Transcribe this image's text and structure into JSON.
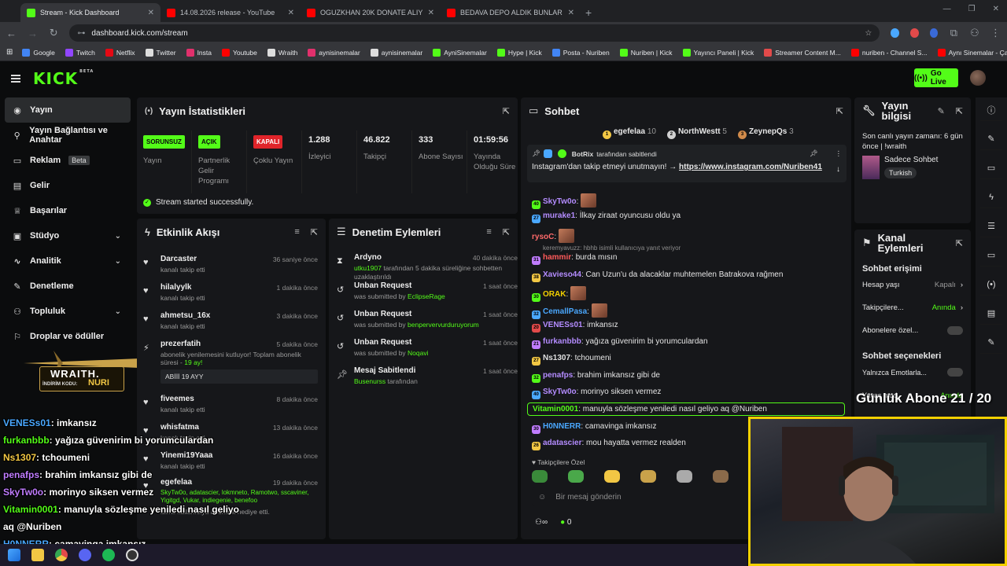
{
  "browser": {
    "tabs": [
      {
        "title": "Stream - Kick Dashboard",
        "color": "#53fc18",
        "active": true
      },
      {
        "title": "14.08.2026 release - YouTube",
        "color": "#ff0000",
        "active": false
      },
      {
        "title": "OGUZKHAN 20K DONATE ALIY",
        "color": "#ff0000",
        "active": false
      },
      {
        "title": "BEDAVA DEPO ALDIK BUNLAR",
        "color": "#ff0000",
        "active": false
      }
    ],
    "url": "dashboard.kick.com/stream",
    "bookmarks": [
      "Google",
      "Twitch",
      "Netflix",
      "Twitter",
      "Insta",
      "Youtube",
      "Wraith",
      "aynisinemalar",
      "aynisinemalar",
      "AyniSinemalar",
      "Hype | Kick",
      "Posta - Nuriben",
      "Nuriben | Kick",
      "Yayıncı Paneli | Kick",
      "Streamer Content M...",
      "nuriben - Channel S...",
      "Aynı Sinemalar - Ça..."
    ]
  },
  "header": {
    "logo": "KICK",
    "beta": "BETA",
    "go_live": "Go Live"
  },
  "sidebar": {
    "items": [
      {
        "label": "Yayın",
        "icon": "broadcast-icon"
      },
      {
        "label": "Yayın Bağlantısı ve Anahtar",
        "icon": "link-icon"
      },
      {
        "label": "Reklam",
        "icon": "ad-icon",
        "tag": "Beta"
      },
      {
        "label": "Gelir",
        "icon": "money-icon"
      },
      {
        "label": "Başarılar",
        "icon": "trophy-icon"
      },
      {
        "label": "Stüdyo",
        "icon": "studio-icon"
      },
      {
        "label": "Analitik",
        "icon": "chart-icon"
      },
      {
        "label": "Denetleme",
        "icon": "wrench-icon"
      },
      {
        "label": "Topluluk",
        "icon": "community-icon"
      },
      {
        "label": "Droplar ve ödüller",
        "icon": "gift-icon"
      }
    ]
  },
  "stats": {
    "title": "Yayın İstatistikleri",
    "items": [
      {
        "badge": "SORUNSUZ",
        "badge_color": "#53fc18",
        "label": "Yayın"
      },
      {
        "badge": "AÇIK",
        "badge_color": "#53fc18",
        "label": "Partnerlik Gelir Programı"
      },
      {
        "badge": "KAPALI",
        "badge_color": "#e0242a",
        "label": "Çoklu Yayın"
      },
      {
        "value": "1.288",
        "label": "İzleyici"
      },
      {
        "value": "46.822",
        "label": "Takipçi"
      },
      {
        "value": "333",
        "label": "Abone Sayısı"
      },
      {
        "value": "01:59:56",
        "label": "Yayında Olduğu Süre"
      }
    ],
    "status": "Stream started successfully."
  },
  "activity": {
    "title": "Etkinlik Akışı",
    "events": [
      {
        "name": "Darcaster",
        "text": "kanalı takip etti",
        "time": "36 saniye önce"
      },
      {
        "name": "hilalyylk",
        "text": "kanalı takip etti",
        "time": "1 dakika önce"
      },
      {
        "name": "ahmetsu_16x",
        "text": "kanalı takip etti",
        "time": "3 dakika önce"
      },
      {
        "name": "prezerfatih",
        "text": "abonelik yenilemesini kutluyor! Toplam abonelik süresi -",
        "highlight": "19 ay!",
        "time": "5 dakika önce",
        "message": "ABİİİ 19 AYY"
      },
      {
        "name": "fiveemes",
        "text": "kanalı takip etti",
        "time": "8 dakika önce"
      },
      {
        "name": "whisfatma",
        "text": "kanalı takip etti",
        "time": "13 dakika önce"
      },
      {
        "name": "Yinemi19Yaaa",
        "text": "kanalı takip etti",
        "time": "16 dakika önce"
      },
      {
        "name": "egefelaa",
        "text": "isimli kullanıcıya abonelik hediye etti.",
        "gifted": "SkyTw0o, adatascier, lokmneto, Ramotwo, sscaviner, Yigitgd, Vukar, indiegenie, benefoo",
        "time": "19 dakika önce"
      }
    ]
  },
  "moderation": {
    "title": "Denetim Eylemleri",
    "actions": [
      {
        "title": "Ardyno",
        "user": "utku1907",
        "text": "tarafından 5 dakika süreliğine sohbetten uzaklaştırıldı",
        "time": "40 dakika önce"
      },
      {
        "title": "Unban Request",
        "text": "was submitted by",
        "user": "EclipseRage",
        "time": "1 saat önce"
      },
      {
        "title": "Unban Request",
        "text": "was submitted by",
        "user": "benpervervurduruyorum",
        "time": "1 saat önce"
      },
      {
        "title": "Unban Request",
        "text": "was submitted by",
        "user": "Noqavi",
        "time": "1 saat önce"
      },
      {
        "title": "Mesaj Sabitlendi",
        "user": "Busenurss",
        "text": "tarafından",
        "time": "1 saat önce"
      }
    ]
  },
  "chat": {
    "title": "Sohbet",
    "top_gifters": [
      {
        "rank": "1",
        "name": "egefelaa",
        "count": "10"
      },
      {
        "rank": "2",
        "name": "NorthWestt",
        "count": "5"
      },
      {
        "rank": "3",
        "name": "ZeynepQs",
        "count": "3"
      }
    ],
    "pinned": {
      "by": "BotRix",
      "by_suffix": "tarafından sabitlendi",
      "text": "Instagram'dan takip etmeyi unutmayın! →",
      "link": "https://www.instagram.com/Nuriben41"
    },
    "reply_note": "keremyavuzz: hbhb isimli kullanıcıya yanıt veriyor",
    "messages": [
      {
        "user": "SkyTw0o",
        "color": "#b48cff",
        "text": "",
        "emote": true,
        "badge": "40"
      },
      {
        "user": "murake1",
        "color": "#b48cff",
        "text": "İlkay ziraat oyuncusu oldu ya",
        "badge": "27"
      },
      {
        "user": "rysoC",
        "color": "#ff6a6a",
        "text": "",
        "emote": true,
        "badge": ""
      },
      {
        "user": "hammir",
        "color": "#ff5a5a",
        "text": "burda mısın",
        "badge": "31"
      },
      {
        "user": "Xavieso44",
        "color": "#b48cff",
        "text": "Can Uzun'u da alacaklar muhtemelen Batrakova rağmen",
        "badge": "38"
      },
      {
        "user": "ORAK",
        "color": "#f2d000",
        "text": "",
        "emote": true,
        "badge": "30"
      },
      {
        "user": "CemallPasa",
        "color": "#4aa8ff",
        "text": "",
        "emote": true,
        "badge": "32"
      },
      {
        "user": "VENESs01",
        "color": "#b48cff",
        "text": "imkansız",
        "badge": "20"
      },
      {
        "user": "furkanbbb",
        "color": "#b48cff",
        "text": "yağıza güvenirim bi yorumculardan",
        "badge": "21"
      },
      {
        "user": "Ns1307",
        "color": "#e0e0e0",
        "text": "tchoumeni",
        "badge": "27"
      },
      {
        "user": "penafps",
        "color": "#b48cff",
        "text": "brahim imkansız gibi de",
        "badge": "32"
      },
      {
        "user": "SkyTw0o",
        "color": "#b48cff",
        "text": "morinyo siksen vermez",
        "badge": "40"
      },
      {
        "user": "Vitamin0001",
        "color": "#53fc18",
        "text": "manuyla sözleşme yeniledi nasıl geliyo aq @Nuriben",
        "badge": "",
        "highlight": true
      },
      {
        "user": "H0NNERR",
        "color": "#4aa8ff",
        "text": "camavinga imkansız",
        "badge": "30"
      },
      {
        "user": "adatascier",
        "color": "#b48cff",
        "text": "mou hayatta vermez realden",
        "badge": "26"
      }
    ],
    "followers_label": "Takipçilere Özel",
    "input_placeholder": "Bir mesaj gönderin",
    "points": "0"
  },
  "stream_info": {
    "title": "Yayın bilgisi",
    "last_live": "Son canlı yayın zamanı: 6 gün önce | !wraith",
    "category": "Sadece Sohbet",
    "language": "Turkish"
  },
  "channel_actions": {
    "title": "Kanal Eylemleri",
    "section1": "Sohbet erişimi",
    "rows": [
      {
        "label": "Hesap yaşı",
        "value": "Kapalı"
      },
      {
        "label": "Takipçilere...",
        "value": "Anında"
      },
      {
        "label": "Abonelere özel...",
        "value": ""
      }
    ],
    "section2": "Sohbet seçenekleri",
    "rows2": [
      {
        "label": "Yalnızca Emotlarla...",
        "value": ""
      },
      {
        "label": "Yavaş mod",
        "value": "Anında"
      }
    ]
  },
  "overlay": {
    "sponsor_name": "WRAITH.",
    "sponsor_code_label": "İNDİRİM KODU:",
    "sponsor_code": "NURI",
    "sub_goal": "Günlük Abone 21 / 20",
    "chat": [
      {
        "user": "VENESs01",
        "text": ": imkansız",
        "color": "#4aa8ff"
      },
      {
        "user": "furkanbbb",
        "text": ": yağıza güvenirim bi yorumculardan",
        "color": "#53fc18"
      },
      {
        "user": "Ns1307",
        "text": ": tchoumeni",
        "color": "#f2c744"
      },
      {
        "user": "penafps",
        "text": ": brahim imkansız gibi de",
        "color": "#c07cff"
      },
      {
        "user": "SkyTw0o",
        "text": ": morinyo siksen vermez",
        "color": "#c07cff"
      },
      {
        "user": "Vitamin0001",
        "text": ": manuyla sözleşme yeniledi nasıl geliyo",
        "color": "#53fc18"
      },
      {
        "user": "",
        "text": "aq @Nuriben",
        "color": "#ffffff"
      },
      {
        "user": "H0NNERR",
        "text": ": camavinga imkansız",
        "color": "#4aa8ff"
      }
    ]
  }
}
